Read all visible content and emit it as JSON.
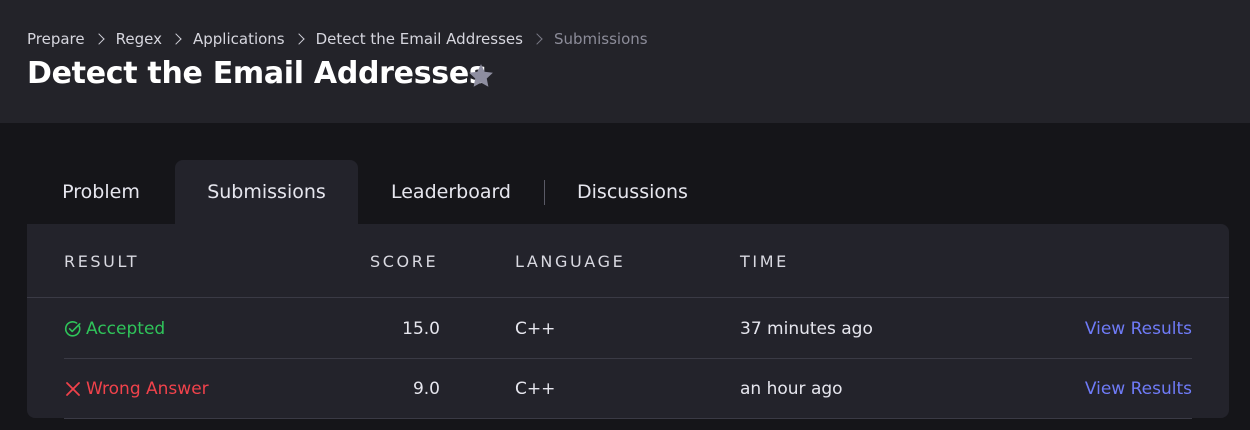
{
  "breadcrumb": [
    "Prepare",
    "Regex",
    "Applications",
    "Detect the Email Addresses",
    "Submissions"
  ],
  "page_title": "Detect the Email Addresses",
  "tabs": [
    "Problem",
    "Submissions",
    "Leaderboard",
    "Discussions"
  ],
  "active_tab": "Submissions",
  "table": {
    "columns": [
      "RESULT",
      "SCORE",
      "LANGUAGE",
      "TIME"
    ],
    "rows": [
      {
        "result": "Accepted",
        "status": "accepted",
        "score": "15.0",
        "language": "C++",
        "time": "37 minutes ago",
        "action": "View Results"
      },
      {
        "result": "Wrong Answer",
        "status": "wrong",
        "score": "9.0",
        "language": "C++",
        "time": "an hour ago",
        "action": "View Results"
      }
    ]
  },
  "icons": {
    "favorite": "star-icon",
    "accepted": "check-circle-icon",
    "wrong": "x-icon",
    "breadcrumb_separator": "chevron-right-icon"
  },
  "colors": {
    "accepted": "#2fc45a",
    "wrong": "#f0424b",
    "link": "#6f7bf7",
    "star": "#8e8ea0"
  }
}
